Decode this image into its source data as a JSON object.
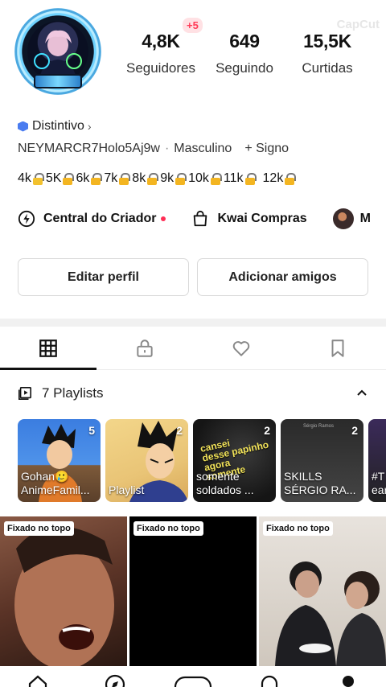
{
  "profile": {
    "stats": [
      {
        "value": "4,8K",
        "label": "Seguidores"
      },
      {
        "value": "649",
        "label": "Seguindo"
      },
      {
        "value": "15,5K",
        "label": "Curtidas"
      }
    ],
    "new_followers_badge": "+5",
    "watermark": "CapCut",
    "distintivo_label": "Distintivo",
    "username": "NEYMARCR7Holo5Aj9w",
    "gender": "Masculino",
    "sign_label": "+ Signo",
    "levels": [
      "4k",
      "5K",
      "6k",
      "7k",
      "8k",
      "9k",
      "10k",
      "11k",
      "12k"
    ]
  },
  "quick_links": {
    "creator": "Central do Criador",
    "shop": "Kwai Compras",
    "more": "M"
  },
  "buttons": {
    "edit": "Editar perfil",
    "add_friends": "Adicionar amigos"
  },
  "playlists": {
    "header": "7 Playlists",
    "items": [
      {
        "title": "Gohan🥲\nAnimeFamil...",
        "count": "5"
      },
      {
        "title": "Playlist",
        "count": "2"
      },
      {
        "title": "somente\nsoldados ...",
        "count": "2",
        "overlay": "cansei\ndesse papinho\nagora\nsomente"
      },
      {
        "title": "SKILLS\nSÉRGIO RA...",
        "count": "2",
        "author": "Sérgio Ramos"
      },
      {
        "title": "#T\near",
        "count": ""
      }
    ]
  },
  "videos": {
    "pinned_label": "Fixado no topo"
  },
  "colors": {
    "accent_red": "#ff2d55",
    "badge_blue": "#4a7cf0",
    "lock_gold": "#f3b521"
  },
  "icons": {
    "tabs": [
      "grid-icon",
      "lock-icon",
      "heart-icon",
      "bookmark-icon"
    ],
    "nav": [
      "home-icon",
      "discover-icon",
      "create-icon",
      "inbox-icon",
      "profile-icon"
    ]
  }
}
